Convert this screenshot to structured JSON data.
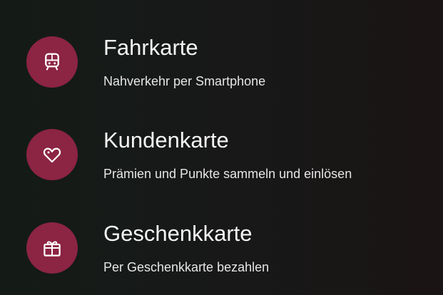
{
  "menu": {
    "items": [
      {
        "title": "Fahrkarte",
        "subtitle": "Nahverkehr per Smartphone",
        "icon": "train-icon"
      },
      {
        "title": "Kundenkarte",
        "subtitle": "Prämien und Punkte sammeln und einlösen",
        "icon": "heart-tag-icon"
      },
      {
        "title": "Geschenkkarte",
        "subtitle": "Per Geschenkkarte bezahlen",
        "icon": "gift-icon"
      }
    ]
  },
  "colors": {
    "icon_circle": "#8c2444",
    "background": "#181818",
    "text": "#f4f4f4"
  }
}
